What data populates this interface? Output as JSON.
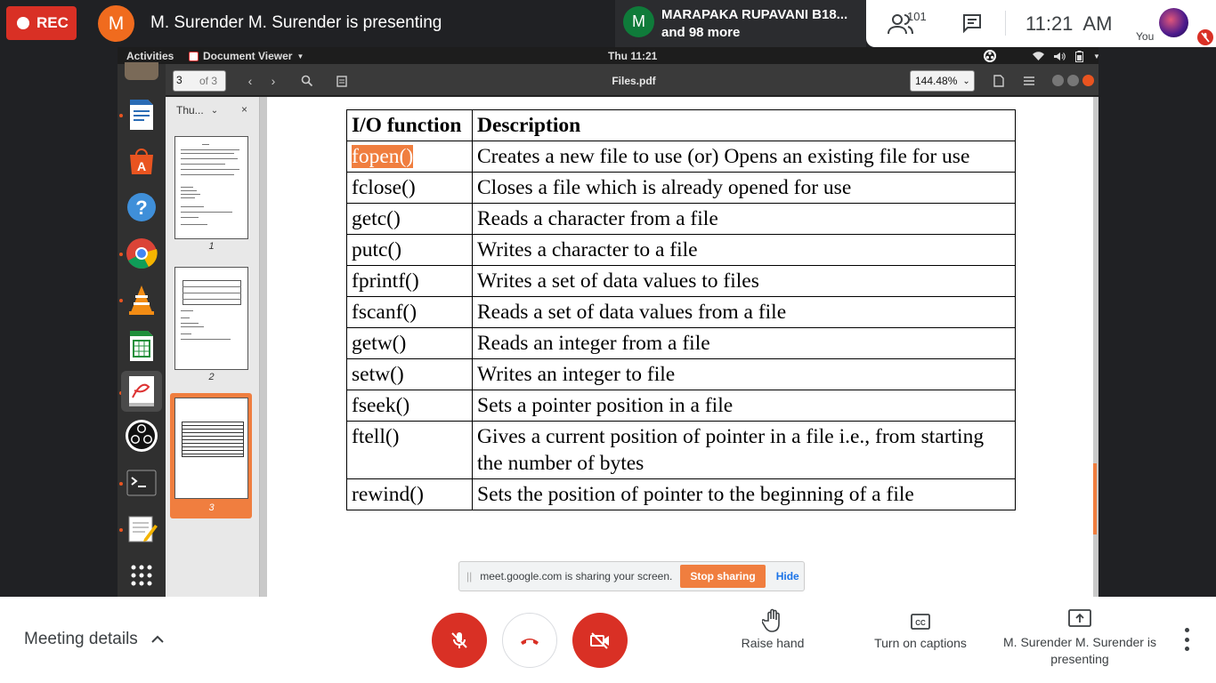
{
  "meet": {
    "rec_label": "REC",
    "presenter_initial": "M",
    "presenter_banner": "M. Surender M. Surender is presenting",
    "participant_initial": "M",
    "participant_name": "MARAPAKA RUPAVANI B18...",
    "participant_more": "and 98 more",
    "people_count": "101",
    "clock": "11:21  AM",
    "self_label": "You",
    "meeting_details": "Meeting details",
    "raise_hand": "Raise hand",
    "captions": "Turn on captions",
    "presenting": "M. Surender M. Surender is presenting",
    "colors": {
      "record_red": "#d93025",
      "presenter_orange": "#f06b1e",
      "participant_green": "#0f7b3a"
    }
  },
  "desktop": {
    "activities": "Activities",
    "app_menu": "Document Viewer",
    "clock": "Thu 11:21"
  },
  "viewer": {
    "page_input": "3",
    "page_of": "of 3",
    "file_title": "Files.pdf",
    "zoom": "144.48%",
    "sidebar_tab": "Thu...",
    "thumbnails": [
      "1",
      "2",
      "3"
    ],
    "accent": "#f07e3f"
  },
  "table": {
    "headers": [
      "I/O function",
      "Description"
    ],
    "rows": [
      {
        "fn": "fopen()",
        "desc": "Creates a new file to use (or) Opens an existing file for use"
      },
      {
        "fn": "fclose()",
        "desc": "Closes a file which is already opened for use"
      },
      {
        "fn": "getc()",
        "desc": "Reads a character from a file"
      },
      {
        "fn": "putc()",
        "desc": "Writes a character to a file"
      },
      {
        "fn": "fprintf()",
        "desc": "Writes a set of data values to files"
      },
      {
        "fn": "fscanf()",
        "desc": "Reads a set of data values from a file"
      },
      {
        "fn": "getw()",
        "desc": "Reads an integer from a file"
      },
      {
        "fn": "setw()",
        "desc": "Writes an integer to file"
      },
      {
        "fn": "fseek()",
        "desc": "Sets a pointer position in a file"
      },
      {
        "fn": "ftell()",
        "desc": "Gives a current position of pointer in a file i.e., from starting the number of bytes"
      },
      {
        "fn": "rewind()",
        "desc": "Sets the position of pointer to the beginning of a file"
      }
    ]
  },
  "share_bar": {
    "grip": "||",
    "text": "meet.google.com is sharing your screen.",
    "stop": "Stop sharing",
    "hide": "Hide"
  }
}
